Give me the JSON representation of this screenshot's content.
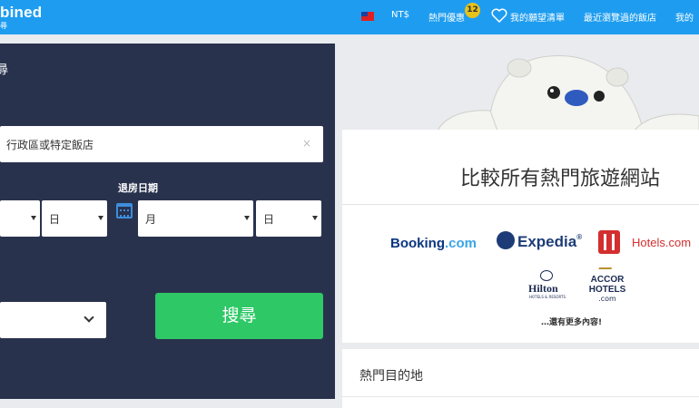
{
  "header": {
    "logo": "bined",
    "logo_sub": "尋",
    "currency": "NT$",
    "deals_label": "熱門優惠",
    "deals_badge": "12",
    "wishlist_label": "我的願望清單",
    "recent_label": "最近瀏覽過的飯店",
    "account_label": "我的",
    "flag": "taiwan-flag"
  },
  "search": {
    "title": "尋",
    "destination_value": "行政區或特定飯店",
    "clear_icon": "×",
    "checkout_label": "退房日期",
    "checkin_day": "日",
    "checkout_month": "月",
    "checkout_day": "日",
    "search_button": "搜尋"
  },
  "compare": {
    "title": "比較所有熱門旅遊網站",
    "providers": {
      "booking_main": "Booking",
      "booking_suffix": ".com",
      "expedia": "Expedia",
      "expedia_mark": "®",
      "hotels": "Hotels.com",
      "hilton": "Hilton",
      "hilton_sub": "HOTELS & RESORTS",
      "accor": "ACCOR\nHOTELS",
      "accor_com": ".com"
    },
    "more": "…還有更多內容!"
  },
  "popular": {
    "title": "熱門目的地"
  },
  "colors": {
    "topbar": "#1e9df0",
    "panel": "#29324d",
    "search_button": "#2ec866",
    "booking": "#0b3680",
    "hotels": "#d32f2f",
    "badge": "#e7c21a"
  }
}
